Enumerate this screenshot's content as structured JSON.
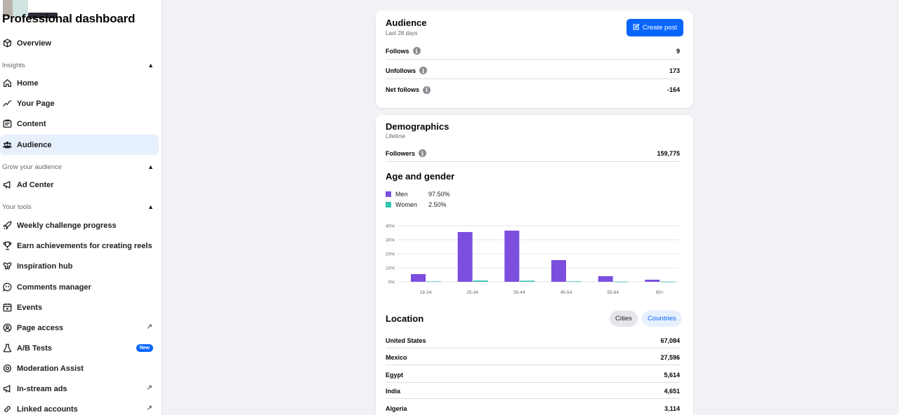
{
  "sidebar": {
    "title": "Professional dashboard",
    "overview": "Overview",
    "sections": {
      "insights": "Insights",
      "grow": "Grow your audience",
      "tools": "Your tools"
    },
    "insights_items": [
      "Home",
      "Your Page",
      "Content",
      "Audience"
    ],
    "grow_items": [
      "Ad Center"
    ],
    "tools_items": [
      "Weekly challenge progress",
      "Earn achievements for creating reels",
      "Inspiration hub",
      "Comments manager",
      "Events",
      "Page access",
      "A/B Tests",
      "Moderation Assist",
      "In-stream ads",
      "Linked accounts"
    ],
    "new_badge": "New",
    "active_item": "Audience"
  },
  "audience": {
    "title": "Audience",
    "subtitle": "Last 28 days",
    "create_post": "Create post",
    "rows": [
      {
        "label": "Follows",
        "value": "9"
      },
      {
        "label": "Unfollows",
        "value": "173"
      },
      {
        "label": "Net follows",
        "value": "-164"
      }
    ]
  },
  "demographics": {
    "title": "Demographics",
    "subtitle": "Lifetime",
    "followers_label": "Followers",
    "followers_value": "159,775",
    "age_gender_title": "Age and gender",
    "legend": [
      {
        "name": "Men",
        "pct": "97.50%",
        "color": "#7b4ee0"
      },
      {
        "name": "Women",
        "pct": "2.50%",
        "color": "#33c2b0"
      }
    ],
    "location_title": "Location",
    "cities_label": "Cities",
    "countries_label": "Countries",
    "locations": [
      {
        "name": "United States",
        "value": "67,084"
      },
      {
        "name": "Mexico",
        "value": "27,596"
      },
      {
        "name": "Egypt",
        "value": "5,614"
      },
      {
        "name": "India",
        "value": "4,651"
      },
      {
        "name": "Algeria",
        "value": "3,114"
      }
    ]
  },
  "chart_data": {
    "type": "bar",
    "categories": [
      "18-24",
      "25-34",
      "35-44",
      "45-54",
      "55-64",
      "65+"
    ],
    "series": [
      {
        "name": "Men",
        "color": "#7b4ee0",
        "values": [
          5.5,
          35.5,
          36.5,
          15.5,
          4,
          1.5
        ]
      },
      {
        "name": "Women",
        "color": "#33c2b0",
        "values": [
          0.3,
          0.9,
          0.8,
          0.3,
          0.1,
          0.1
        ]
      }
    ],
    "yticks": [
      "40%",
      "30%",
      "20%",
      "10%",
      "0%"
    ],
    "ylim": [
      0,
      40
    ],
    "grid": true
  }
}
